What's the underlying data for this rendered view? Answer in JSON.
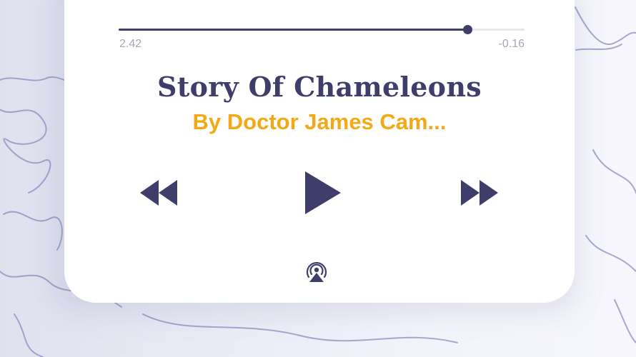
{
  "player": {
    "progress_fraction": 0.86,
    "elapsed": "2.42",
    "remaining": "-0.16",
    "title": "Story Of Chameleons",
    "author": "By Doctor James Cam..."
  },
  "icons": {
    "rewind": "rewind-icon",
    "play": "play-icon",
    "forward": "fast-forward-icon",
    "airplay": "airplay-icon"
  },
  "colors": {
    "primary": "#3f3d6a",
    "accent": "#f2a915",
    "muted": "#a6a6b8",
    "card": "#ffffff"
  }
}
